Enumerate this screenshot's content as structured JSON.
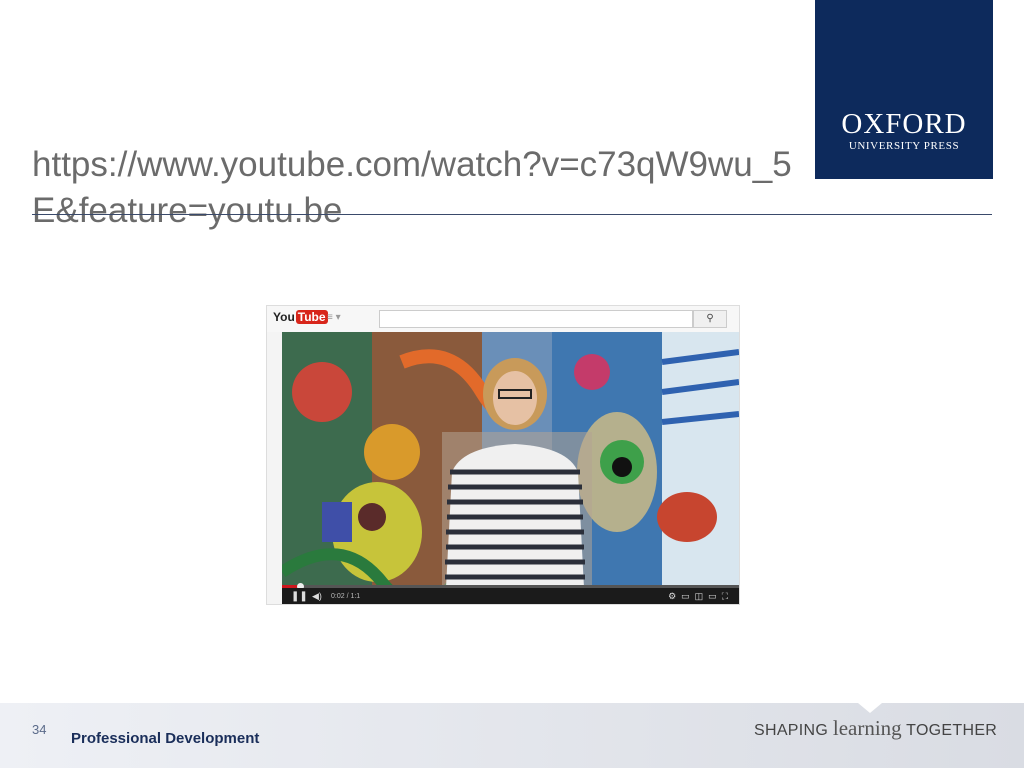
{
  "logo": {
    "name": "OXFORD",
    "subtitle": "UNIVERSITY PRESS",
    "bg_color": "#0d2a5c"
  },
  "slide": {
    "title_link": "https://www.youtube.com/watch?v=c73qW9wu_5E&feature=youtu.be"
  },
  "screenshot": {
    "site_logo_left": "You",
    "site_logo_right": "Tube",
    "menu_icon": "menu-icon",
    "search_icon": "search-icon",
    "video_time": "0:02 / 1:1",
    "progress": 0.04,
    "controls": {
      "play_icon": "pause-icon",
      "volume_icon": "volume-icon",
      "right_icons": [
        "settings-icon",
        "captions-icon",
        "miniplayer-icon",
        "theater-icon",
        "fullscreen-icon"
      ]
    }
  },
  "footer": {
    "page_number": "34",
    "label": "Professional Development",
    "tagline_left": "SHAPING",
    "tagline_mid": "learning",
    "tagline_right": "TOGETHER"
  }
}
